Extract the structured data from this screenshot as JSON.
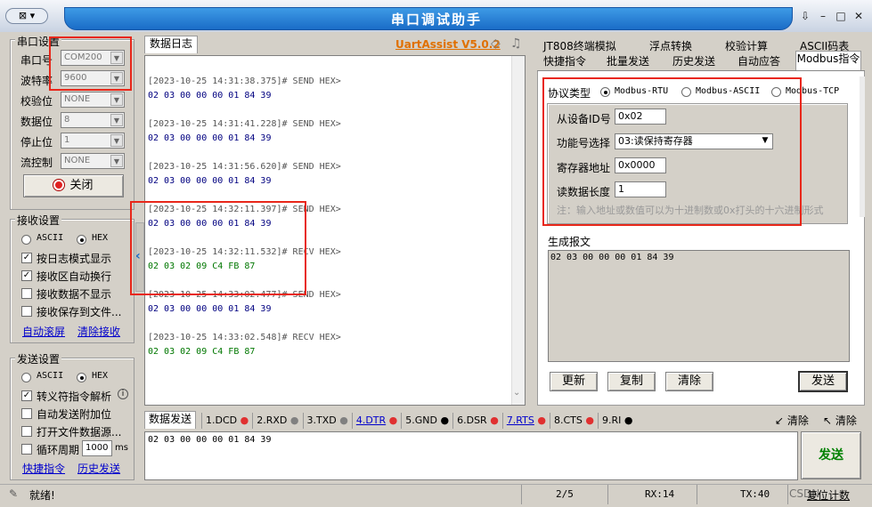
{
  "window": {
    "title": "串口调试助手",
    "sys_menu": "▾",
    "pin_label": "↓"
  },
  "port_settings": {
    "title": "串口设置",
    "port_label": "串口号",
    "port_value": "COM200",
    "baud_label": "波特率",
    "baud_value": "9600",
    "parity_label": "校验位",
    "parity_value": "NONE",
    "databits_label": "数据位",
    "databits_value": "8",
    "stopbits_label": "停止位",
    "stopbits_value": "1",
    "flow_label": "流控制",
    "flow_value": "NONE",
    "close_button": "关闭"
  },
  "receive_settings": {
    "title": "接收设置",
    "ascii": "ASCII",
    "hex": "HEX",
    "mode": "HEX",
    "options": [
      {
        "label": "按日志模式显示",
        "checked": true
      },
      {
        "label": "接收区自动换行",
        "checked": true
      },
      {
        "label": "接收数据不显示",
        "checked": false
      },
      {
        "label": "接收保存到文件...",
        "checked": false
      }
    ],
    "auto_scroll": "自动滚屏",
    "clear_receive": "清除接收"
  },
  "send_settings": {
    "title": "发送设置",
    "ascii": "ASCII",
    "hex": "HEX",
    "mode": "HEX",
    "options": [
      {
        "label": "转义符指令解析",
        "checked": true
      },
      {
        "label": "自动发送附加位",
        "checked": false
      },
      {
        "label": "打开文件数据源...",
        "checked": false
      }
    ],
    "cycle_label": "循环周期",
    "cycle_value": "1000",
    "cycle_unit": "ms",
    "shortcut_cmd": "快捷指令",
    "history_send": "历史发送"
  },
  "log": {
    "tab": "数据日志",
    "brand": "UartAssist V5.0.2",
    "entries": [
      {
        "header": "[2023-10-25 14:31:38.375]# SEND HEX>",
        "data": "02 03 00 00 00 01 84 39",
        "dir": "send"
      },
      {
        "header": "[2023-10-25 14:31:41.228]# SEND HEX>",
        "data": "02 03 00 00 00 01 84 39",
        "dir": "send"
      },
      {
        "header": "[2023-10-25 14:31:56.620]# SEND HEX>",
        "data": "02 03 00 00 00 01 84 39",
        "dir": "send"
      },
      {
        "header": "[2023-10-25 14:32:11.397]# SEND HEX>",
        "data": "02 03 00 00 00 01 84 39",
        "dir": "send"
      },
      {
        "header": "[2023-10-25 14:32:11.532]# RECV HEX>",
        "data": "02 03 02 09 C4 FB 87",
        "dir": "recv"
      },
      {
        "header": "[2023-10-25 14:33:02.477]# SEND HEX>",
        "data": "02 03 00 00 00 01 84 39",
        "dir": "send"
      },
      {
        "header": "[2023-10-25 14:33:02.548]# RECV HEX>",
        "data": "02 03 02 09 C4 FB 87",
        "dir": "recv"
      }
    ],
    "collapse_arrow": "‹"
  },
  "send_area": {
    "tab": "数据发送",
    "signals": [
      {
        "label": "1.DCD",
        "dot": "#e03030"
      },
      {
        "label": "2.RXD",
        "dot": "#808080"
      },
      {
        "label": "3.TXD",
        "dot": "#808080"
      },
      {
        "label": "4.DTR",
        "dot": "#e03030",
        "link": true
      },
      {
        "label": "5.GND",
        "dot": "#000000"
      },
      {
        "label": "6.DSR",
        "dot": "#e03030"
      },
      {
        "label": "7.RTS",
        "dot": "#e03030",
        "link": true
      },
      {
        "label": "8.CTS",
        "dot": "#e03030"
      },
      {
        "label": "9.RI",
        "dot": "#000000"
      }
    ],
    "clear1": "清除",
    "clear2": "清除",
    "input_value": "02 03 00 00 00 01 84 39",
    "send_button": "发送"
  },
  "right_tabs": {
    "row1": [
      "JT808终端模拟",
      "浮点转换",
      "校验计算",
      "ASCII码表"
    ],
    "row2": [
      "快捷指令",
      "批量发送",
      "历史发送",
      "自动应答",
      "Modbus指令"
    ],
    "active": "Modbus指令"
  },
  "modbus": {
    "protocol_label": "协议类型",
    "protocols": [
      "Modbus-RTU",
      "Modbus-ASCII",
      "Modbus-TCP"
    ],
    "selected_protocol": "Modbus-RTU",
    "slave_label": "从设备ID号",
    "slave_value": "0x02",
    "func_label": "功能号选择",
    "func_value": "03:读保持寄存器",
    "addr_label": "寄存器地址",
    "addr_value": "0x0000",
    "len_label": "读数据长度",
    "len_value": "1",
    "note": "注：输入地址或数值可以为十进制数或0x打头的十六进制形式",
    "result_label": "生成报文",
    "result_value": "02 03 00 00 00 01 84 39",
    "buttons": {
      "update": "更新",
      "copy": "复制",
      "clear": "清除",
      "send": "发送"
    }
  },
  "status": {
    "ready": "就绪!",
    "count": "2/5",
    "rx": "RX:14",
    "tx": "TX:40",
    "reset": "复位计数",
    "watermark": "CSDN"
  },
  "colors": {
    "accent": "#1a6cc7",
    "highlight": "#e8271a",
    "recv": "#007700",
    "send": "#000080"
  }
}
